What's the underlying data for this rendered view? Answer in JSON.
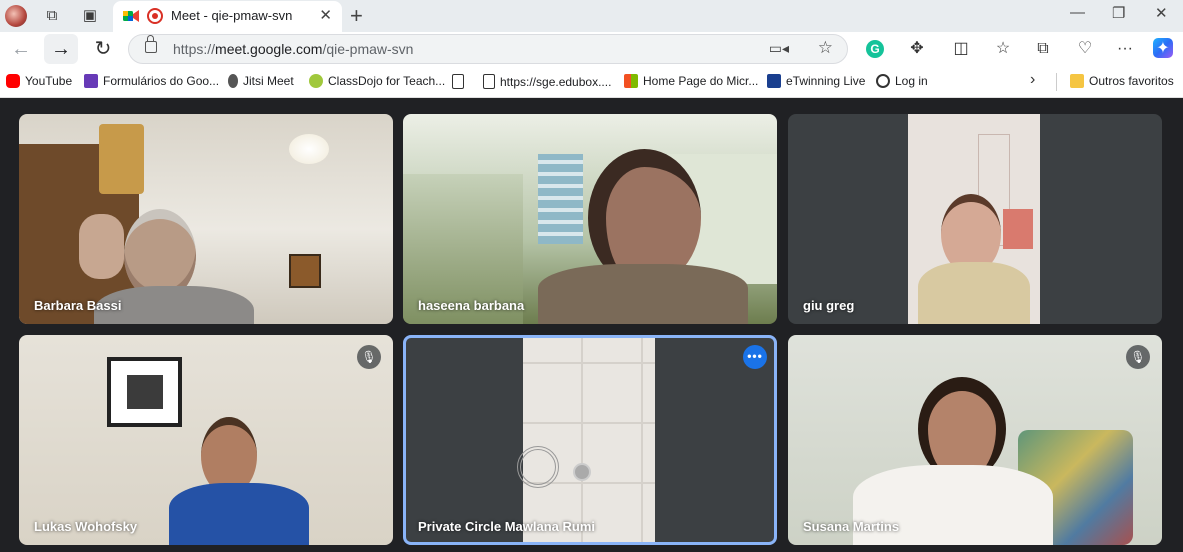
{
  "browser": {
    "tab": {
      "title": "Meet - qie-pmaw-svn"
    },
    "address": {
      "url_prefix": "https://",
      "url_host": "meet.google.com",
      "url_path": "/qie-pmaw-svn"
    },
    "bookmarks": [
      {
        "label": "YouTube",
        "color": "#ff0000"
      },
      {
        "label": "Formulários do Goo...",
        "color": "#673ab7"
      },
      {
        "label": "Jitsi Meet",
        "color": "#555555"
      },
      {
        "label": "ClassDojo for Teach...",
        "color": "#a0c83c"
      },
      {
        "label": "",
        "color": "#ffffff"
      },
      {
        "label": "https://sge.edubox....",
        "color": "#ffffff"
      },
      {
        "label": "Home Page do Micr...",
        "color": "#f25022"
      },
      {
        "label": "eTwinning Live",
        "color": "#1a3f8f"
      },
      {
        "label": "Log in",
        "color": "#333333"
      }
    ],
    "other_favorites": "Outros favoritos"
  },
  "meet": {
    "participants": [
      {
        "name": "Barbara Bassi",
        "muted": false,
        "speaking": false
      },
      {
        "name": "haseena barbana",
        "muted": false,
        "speaking": false
      },
      {
        "name": "giu greg",
        "muted": false,
        "speaking": false
      },
      {
        "name": "Lukas Wohofsky",
        "muted": true,
        "speaking": false
      },
      {
        "name": "Private Circle Mawlana Rumi",
        "muted": false,
        "speaking": true
      },
      {
        "name": "Susana Martins",
        "muted": true,
        "speaking": false
      }
    ]
  },
  "colors": {
    "accent": "#1a73e8",
    "speaking_border": "#8ab4f8",
    "meet_bg": "#202124"
  }
}
